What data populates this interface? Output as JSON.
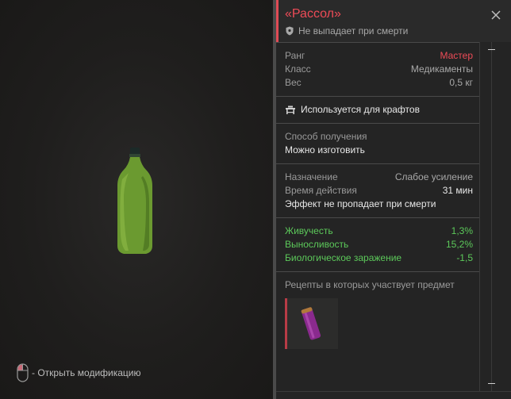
{
  "viewer": {
    "hint_text": "- Открыть модификацию"
  },
  "item": {
    "title": "«Рассол»",
    "subtitle": "Не выпадает при смерти",
    "stats": [
      {
        "label": "Ранг",
        "value": "Мастер",
        "color": "#ee4b57"
      },
      {
        "label": "Класс",
        "value": "Медикаменты"
      },
      {
        "label": "Вес",
        "value": "0,5 кг"
      }
    ],
    "craft_text": "Используется для крафтов",
    "obtain": {
      "label": "Способ получения",
      "value": "Можно изготовить"
    },
    "purpose": {
      "label": "Назначение",
      "value": "Слабое усиление",
      "duration_label": "Время действия",
      "duration_value": "31 мин",
      "effect_note": "Эффект не пропадает при смерти"
    },
    "effects": [
      {
        "label": "Живучесть",
        "value": "1,3%"
      },
      {
        "label": "Выносливость",
        "value": "15,2%"
      },
      {
        "label": "Биологическое заражение",
        "value": "-1,5"
      }
    ],
    "recipes_label": "Рецепты в которых участвует предмет"
  },
  "colors": {
    "accent": "#ee4b57",
    "positive": "#5cc95a"
  }
}
